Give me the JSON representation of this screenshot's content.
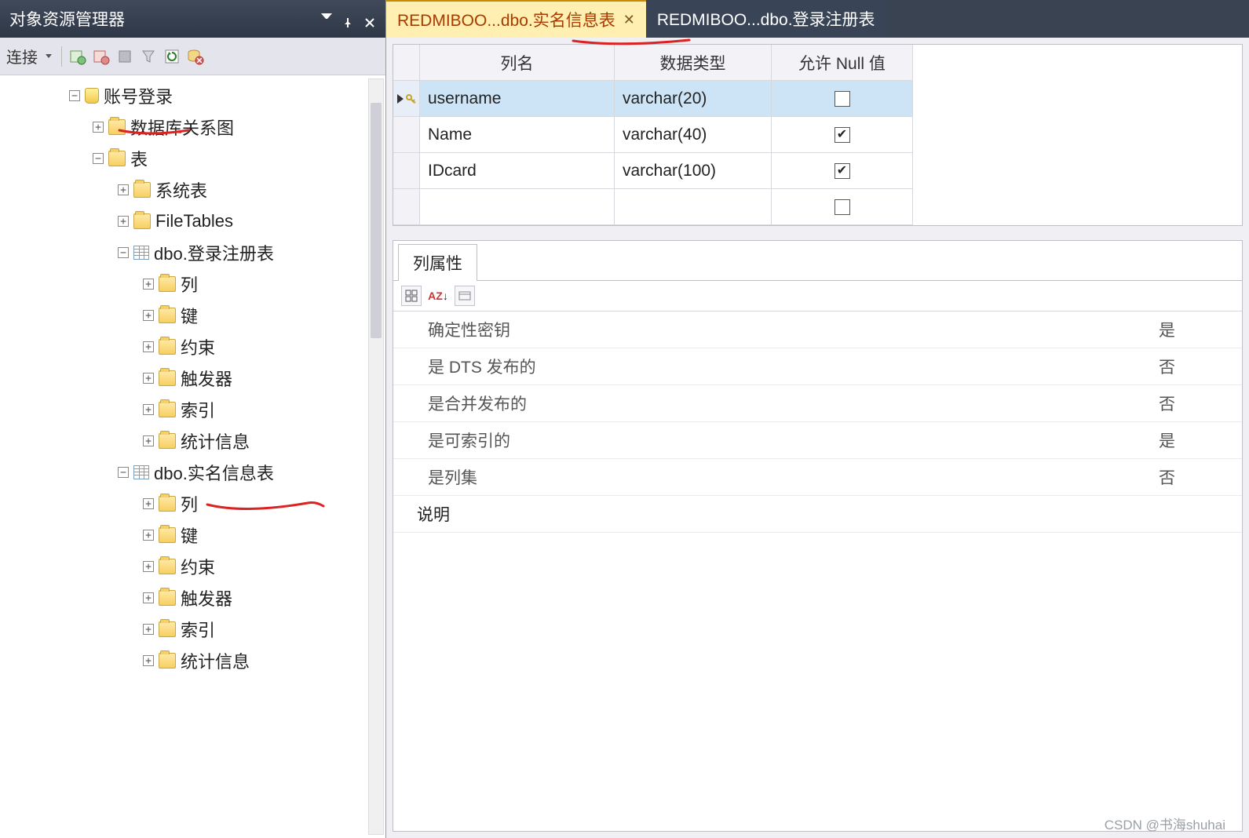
{
  "panel": {
    "title": "对象资源管理器",
    "connect_label": "连接"
  },
  "tree": [
    {
      "indent": 88,
      "exp": "-",
      "icon": "db",
      "label": "账号登录"
    },
    {
      "indent": 118,
      "exp": "+",
      "icon": "folder",
      "label": "数据库关系图"
    },
    {
      "indent": 118,
      "exp": "-",
      "icon": "folder",
      "label": "表"
    },
    {
      "indent": 150,
      "exp": "+",
      "icon": "folder",
      "label": "系统表"
    },
    {
      "indent": 150,
      "exp": "+",
      "icon": "folder",
      "label": "FileTables"
    },
    {
      "indent": 150,
      "exp": "-",
      "icon": "table",
      "label": "dbo.登录注册表"
    },
    {
      "indent": 182,
      "exp": "+",
      "icon": "folder",
      "label": "列"
    },
    {
      "indent": 182,
      "exp": "+",
      "icon": "folder",
      "label": "键"
    },
    {
      "indent": 182,
      "exp": "+",
      "icon": "folder",
      "label": "约束"
    },
    {
      "indent": 182,
      "exp": "+",
      "icon": "folder",
      "label": "触发器"
    },
    {
      "indent": 182,
      "exp": "+",
      "icon": "folder",
      "label": "索引"
    },
    {
      "indent": 182,
      "exp": "+",
      "icon": "folder",
      "label": "统计信息"
    },
    {
      "indent": 150,
      "exp": "-",
      "icon": "table",
      "label": "dbo.实名信息表"
    },
    {
      "indent": 182,
      "exp": "+",
      "icon": "folder",
      "label": "列"
    },
    {
      "indent": 182,
      "exp": "+",
      "icon": "folder",
      "label": "键"
    },
    {
      "indent": 182,
      "exp": "+",
      "icon": "folder",
      "label": "约束"
    },
    {
      "indent": 182,
      "exp": "+",
      "icon": "folder",
      "label": "触发器"
    },
    {
      "indent": 182,
      "exp": "+",
      "icon": "folder",
      "label": "索引"
    },
    {
      "indent": 182,
      "exp": "+",
      "icon": "folder",
      "label": "统计信息"
    }
  ],
  "tabs": {
    "active": "REDMIBOO...dbo.实名信息表",
    "inactive": "REDMIBOO...dbo.登录注册表"
  },
  "grid": {
    "headers": {
      "rowhead": "",
      "name": "列名",
      "type": "数据类型",
      "null": "允许 Null 值"
    },
    "rows": [
      {
        "pk": true,
        "name": "username",
        "type": "varchar(20)",
        "allow_null": false,
        "selected": true
      },
      {
        "pk": false,
        "name": "Name",
        "type": "varchar(40)",
        "allow_null": true,
        "selected": false
      },
      {
        "pk": false,
        "name": "IDcard",
        "type": "varchar(100)",
        "allow_null": true,
        "selected": false
      },
      {
        "pk": false,
        "name": "",
        "type": "",
        "allow_null": false,
        "selected": false
      }
    ]
  },
  "props": {
    "tab_label": "列属性",
    "rows": [
      {
        "name": "确定性密钥",
        "val": "是"
      },
      {
        "name": "是 DTS 发布的",
        "val": "否"
      },
      {
        "name": "是合并发布的",
        "val": "否"
      },
      {
        "name": "是可索引的",
        "val": "是"
      },
      {
        "name": "是列集",
        "val": "否"
      }
    ],
    "desc_label": "说明"
  },
  "watermark": "CSDN @书海shuhai"
}
